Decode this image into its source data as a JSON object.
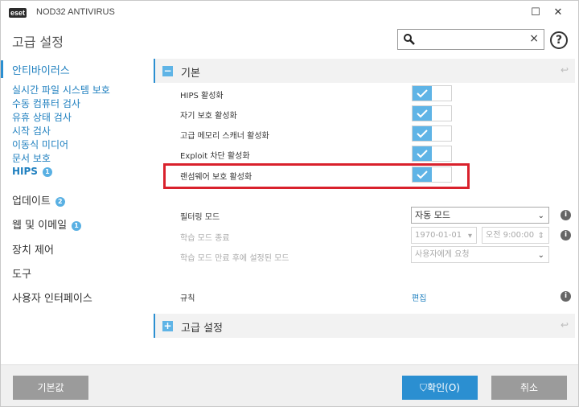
{
  "window": {
    "logo": "eset",
    "app_title": "NOD32 ANTIVIRUS",
    "minimize": "☐",
    "close": "✕"
  },
  "header": {
    "page_title": "고급 설정",
    "search_placeholder": "",
    "search_clear": "×",
    "help": "?"
  },
  "sidebar": {
    "antivirus": "안티바이러스",
    "subitems": [
      "실시간 파일 시스템 보호",
      "수동 컴퓨터 검사",
      "유휴 상태 검사",
      "시작 검사",
      "이동식 미디어",
      "문서 보호"
    ],
    "hips": "HIPS",
    "hips_badge": "1",
    "update": "업데이트",
    "update_badge": "2",
    "web_email": "웹 및 이메일",
    "web_email_badge": "1",
    "device_control": "장치 제어",
    "tools": "도구",
    "user_interface": "사용자 인터페이스"
  },
  "main": {
    "section_basic": "기본",
    "section_basic_toggle": "−",
    "settings": [
      {
        "label": "HIPS 활성화",
        "checked": true
      },
      {
        "label": "자기 보호 활성화",
        "checked": true
      },
      {
        "label": "고급 메모리 스캐너 활성화",
        "checked": true
      },
      {
        "label": "Exploit 차단 활성화",
        "checked": true
      },
      {
        "label": "랜섬웨어 보호 활성화",
        "checked": true
      }
    ],
    "filter_mode_label": "필터링 모드",
    "filter_mode_value": "자동 모드",
    "learning_end_label": "학습 모드 종료",
    "learning_end_date": "1970-01-01",
    "learning_end_time": "오전   9:00:00",
    "learning_after_label": "학습 모드 만료 후에 설정된 모드",
    "learning_after_value": "사용자에게 요청",
    "rules_label": "규칙",
    "rules_link": "편집",
    "section_advanced": "고급 설정",
    "section_advanced_toggle": "+"
  },
  "footer": {
    "default_button": "기본값",
    "ok_button": "확인(O)",
    "cancel_button": "취소"
  },
  "colors": {
    "accent": "#2b8fd1",
    "toggle_on": "#5fb4e6",
    "highlight": "#d9212c"
  }
}
